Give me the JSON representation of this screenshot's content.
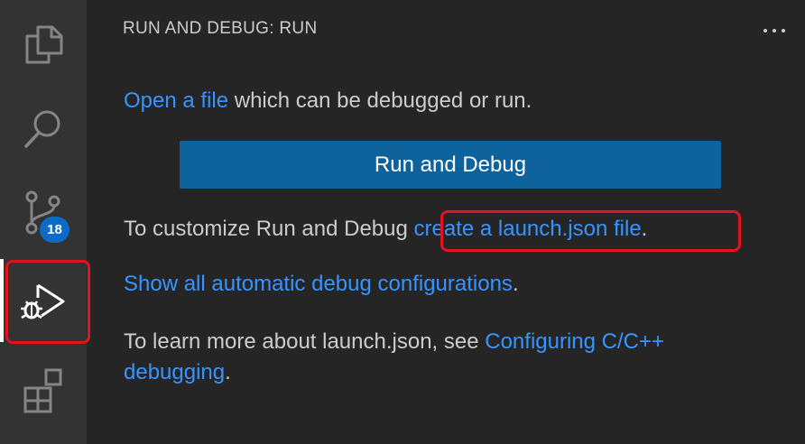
{
  "activity_bar": {
    "items": [
      {
        "name": "explorer",
        "icon": "files-icon"
      },
      {
        "name": "search",
        "icon": "search-icon"
      },
      {
        "name": "source-control",
        "icon": "source-control-icon",
        "badge": "18"
      },
      {
        "name": "run-and-debug",
        "icon": "run-debug-icon",
        "active": true
      },
      {
        "name": "extensions",
        "icon": "extensions-icon"
      }
    ]
  },
  "panel": {
    "title": "RUN AND DEBUG: RUN",
    "more_actions_icon": "ellipsis-icon",
    "open_file": {
      "link": "Open a file",
      "text": " which can be debugged or run."
    },
    "run_button_label": "Run and Debug",
    "customize": {
      "text": "To customize Run and Debug ",
      "link": "create a launch.json file",
      "suffix": "."
    },
    "show_all": {
      "link": "Show all automatic debug configurations",
      "suffix": "."
    },
    "learn_more": {
      "text": "To learn more about launch.json, see ",
      "link_part1": "Configuring C/C++",
      "link_part2": "debugging",
      "suffix": "."
    }
  },
  "colors": {
    "activity_bar_bg": "#333333",
    "sidebar_bg": "#252526",
    "link": "#3794ff",
    "button_bg": "#0e639c",
    "badge_bg": "#0e6ac7",
    "highlight": "#e5121d"
  }
}
